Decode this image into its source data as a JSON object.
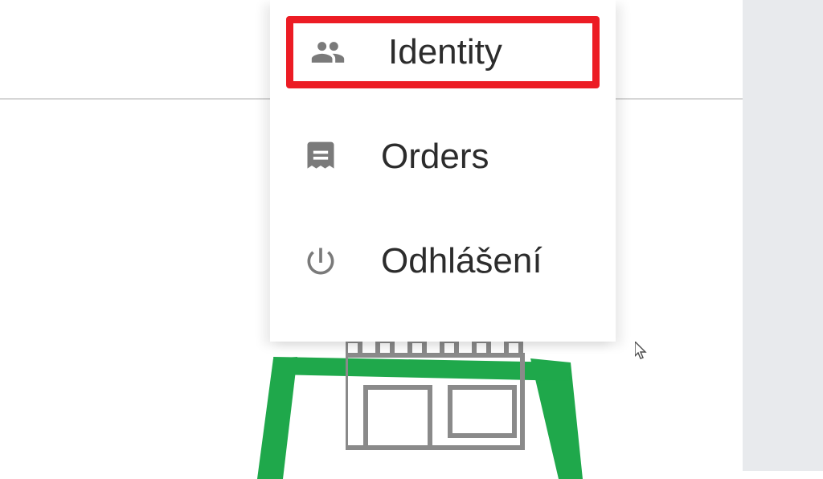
{
  "menu": {
    "items": [
      {
        "label": "Identity",
        "highlighted": true
      },
      {
        "label": "Orders",
        "highlighted": false
      },
      {
        "label": "Odhlášení",
        "highlighted": false
      }
    ]
  },
  "annotation": {
    "highlight_color": "#ec1c24"
  }
}
